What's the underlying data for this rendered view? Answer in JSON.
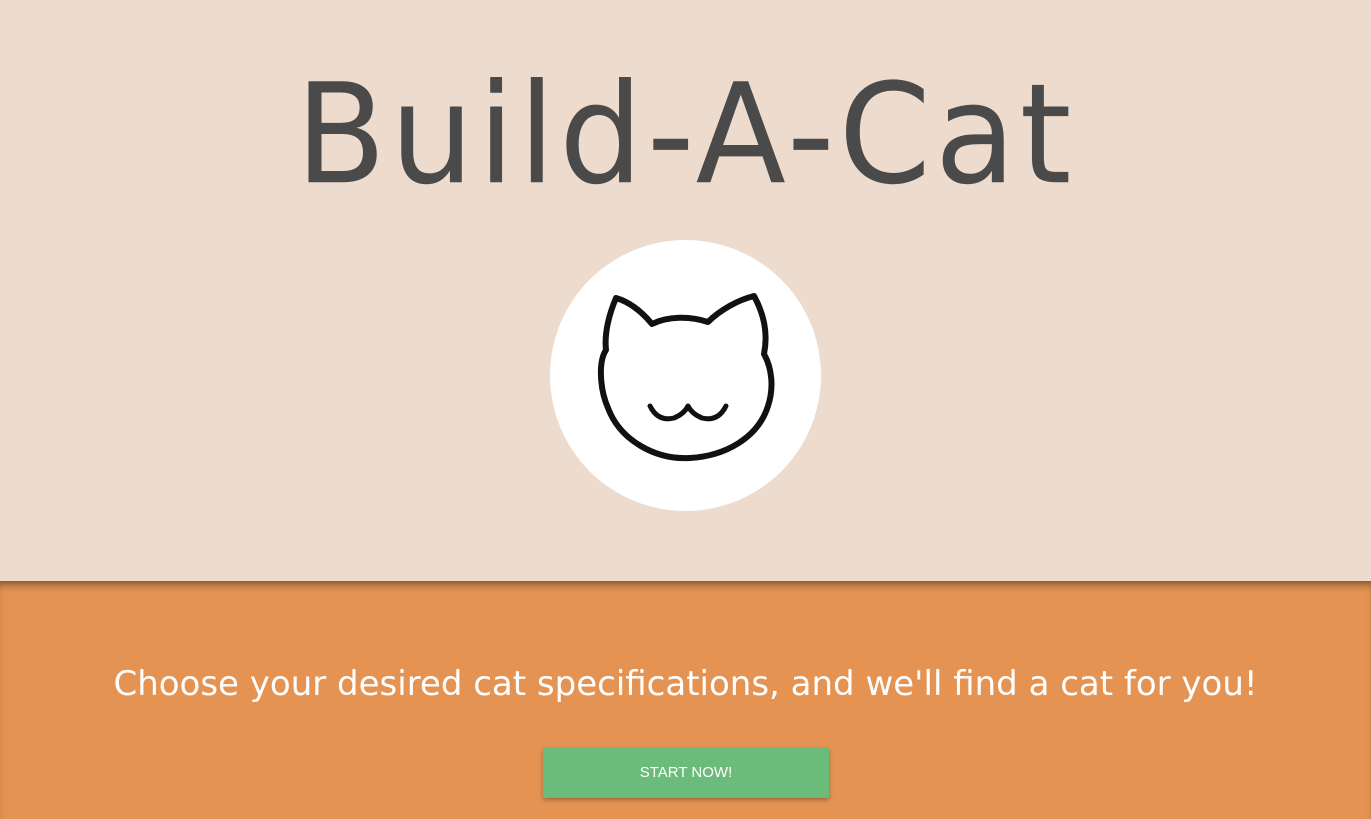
{
  "hero": {
    "title": "Build-A-Cat",
    "logo_icon": "cat-face-icon",
    "background": "#eddbcd"
  },
  "cta": {
    "tagline": "Choose your desired cat specifications, and we'll find a cat for you!",
    "button_label": "START NOW!",
    "background": "#e49352",
    "button_color": "#6bbb7b"
  }
}
